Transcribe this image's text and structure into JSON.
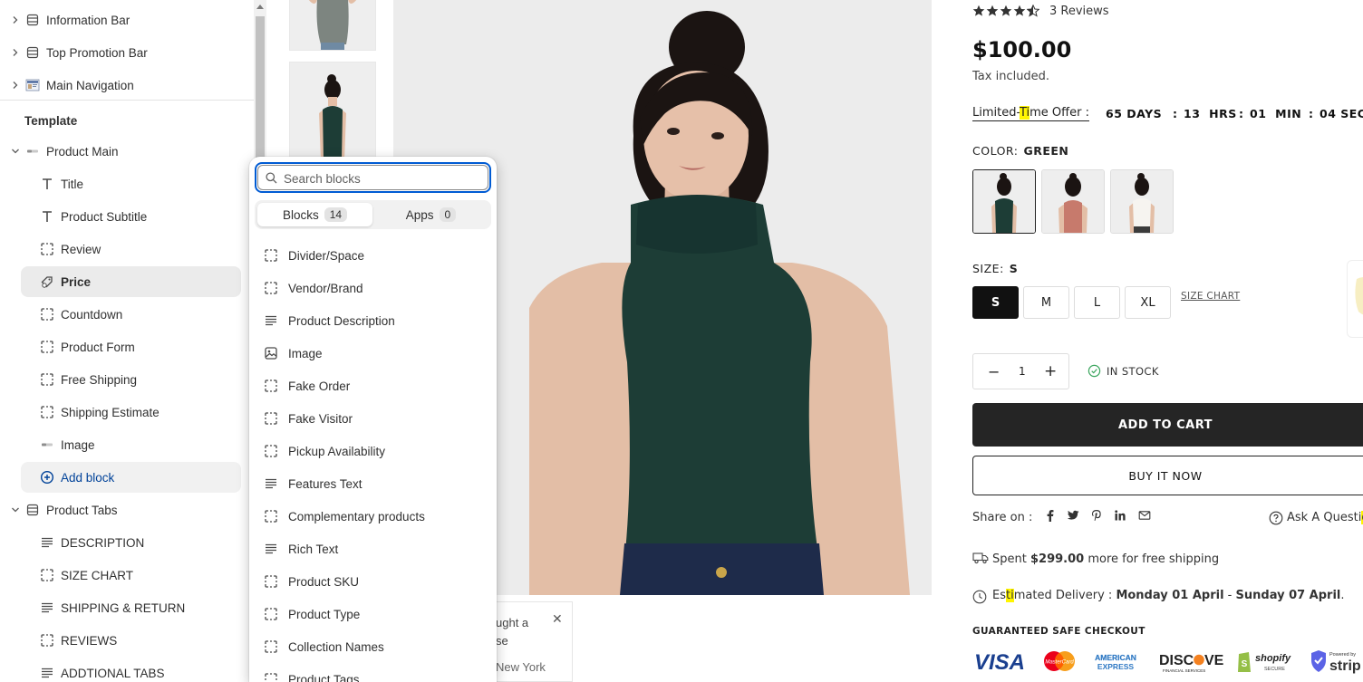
{
  "sidebar": {
    "header_items": [
      {
        "label": "Information Bar",
        "icon": "section-icon"
      },
      {
        "label": "Top Promotion Bar",
        "icon": "section-icon"
      },
      {
        "label": "Main Navigation",
        "icon": "navigation-thumbnail-icon"
      }
    ],
    "template_title": "Template",
    "product_main": {
      "label": "Product Main",
      "blocks": [
        {
          "label": "Title",
          "icon": "text-icon"
        },
        {
          "label": "Product Subtitle",
          "icon": "text-icon"
        },
        {
          "label": "Review",
          "icon": "block-icon"
        },
        {
          "label": "Price",
          "icon": "price-tag-icon"
        },
        {
          "label": "Countdown",
          "icon": "block-icon"
        },
        {
          "label": "Product Form",
          "icon": "block-icon"
        },
        {
          "label": "Free Shipping",
          "icon": "block-icon"
        },
        {
          "label": "Shipping Estimate",
          "icon": "block-icon"
        },
        {
          "label": "Image",
          "icon": "image-thumbnail-icon"
        }
      ],
      "add_block": "Add block"
    },
    "product_tabs": {
      "label": "Product Tabs",
      "blocks": [
        {
          "label": "DESCRIPTION",
          "icon": "paragraph-icon"
        },
        {
          "label": "SIZE CHART",
          "icon": "block-icon"
        },
        {
          "label": "SHIPPING & RETURN",
          "icon": "paragraph-icon"
        },
        {
          "label": "REVIEWS",
          "icon": "block-icon"
        },
        {
          "label": "ADDTIONAL TABS",
          "icon": "paragraph-icon"
        }
      ]
    }
  },
  "block_picker": {
    "search_placeholder": "Search blocks",
    "tabs": [
      {
        "label": "Blocks",
        "count": "14"
      },
      {
        "label": "Apps",
        "count": "0"
      }
    ],
    "items": [
      {
        "label": "Divider/Space",
        "icon": "block-icon"
      },
      {
        "label": "Vendor/Brand",
        "icon": "block-icon"
      },
      {
        "label": "Product Description",
        "icon": "paragraph-icon"
      },
      {
        "label": "Image",
        "icon": "image-icon"
      },
      {
        "label": "Fake Order",
        "icon": "block-icon"
      },
      {
        "label": "Fake Visitor",
        "icon": "block-icon"
      },
      {
        "label": "Pickup Availability",
        "icon": "block-icon"
      },
      {
        "label": "Features Text",
        "icon": "paragraph-icon"
      },
      {
        "label": "Complementary products",
        "icon": "block-icon"
      },
      {
        "label": "Rich Text",
        "icon": "paragraph-icon"
      },
      {
        "label": "Product SKU",
        "icon": "block-icon"
      },
      {
        "label": "Product Type",
        "icon": "block-icon"
      },
      {
        "label": "Collection Names",
        "icon": "block-icon"
      },
      {
        "label": "Product Tags",
        "icon": "block-icon"
      }
    ]
  },
  "fake_order": {
    "line1": "ught a",
    "line2": "se",
    "line3": "New York"
  },
  "product": {
    "rating": 4.5,
    "reviews": "3 Reviews",
    "price": "$100.00",
    "tax": "Tax included.",
    "limited_offer_pre": "Limited-",
    "limited_offer_hl": "Ti",
    "limited_offer_post": "me Offer :",
    "countdown": [
      {
        "value": "65",
        "unit": "DAYS"
      },
      {
        "value": "13",
        "unit": "HRS"
      },
      {
        "value": "01",
        "unit": "MIN"
      },
      {
        "value": "04",
        "unit": "SEC"
      }
    ],
    "color_label": "COLOR:",
    "color_value": "GREEN",
    "size_label": "SIZE:",
    "size_value": "S",
    "sizes": [
      "S",
      "M",
      "L",
      "XL"
    ],
    "size_chart": "SIZE CHART",
    "quantity": "1",
    "stock": "IN STOCK",
    "add_to_cart": "ADD TO CART",
    "buy_now": "BUY IT NOW",
    "share_label": "Share on :",
    "ask_pre": "Ask A Questi",
    "ask_hl": "o",
    "shipping_pre": "Spent ",
    "shipping_amount": "$299.00",
    "shipping_post": " more for free shipping",
    "delivery_pre": "Es",
    "delivery_hl": "ti",
    "delivery_mid": "mated Delivery : ",
    "delivery_from": "Monday 01 April",
    "delivery_sep": " - ",
    "delivery_to": "Sunday 07 April",
    "delivery_end": ".",
    "guaranteed": "GUARANTEED SAFE CHECKOUT",
    "payments": [
      "VISA",
      "MasterCard",
      "AMERICAN EXPRESS",
      "DISCOVER",
      "shopify SECURE",
      "Powered by stripe"
    ]
  },
  "colors": {
    "accent": "#005bd3",
    "add_to_cart_bg": "#252525",
    "highlight": "#fff500",
    "garment_green": "#1d3d36"
  }
}
